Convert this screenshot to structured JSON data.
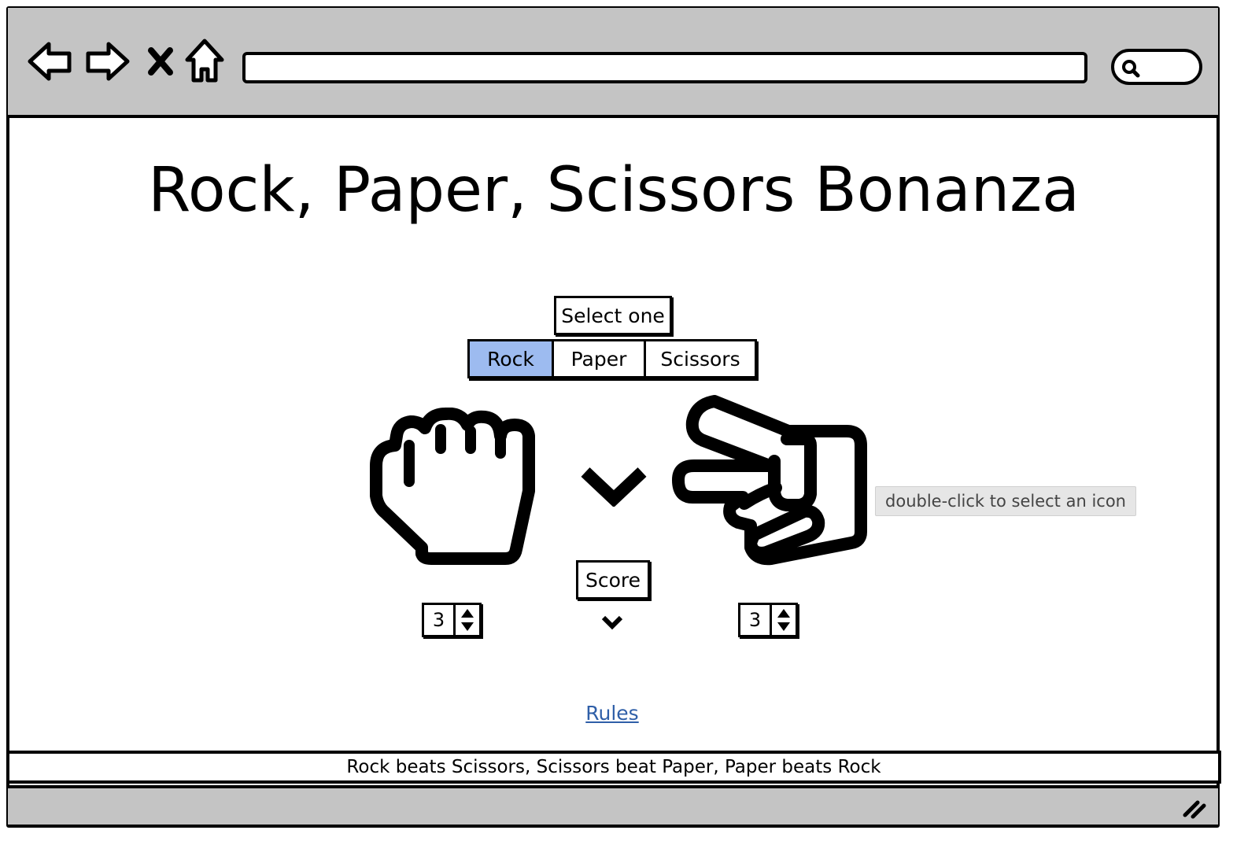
{
  "browser": {
    "back_icon": "back-arrow-icon",
    "forward_icon": "forward-arrow-icon",
    "close_icon": "close-x-icon",
    "home_icon": "home-icon",
    "search_icon": "search-icon",
    "resize_icon": "resize-grip-icon",
    "url": ""
  },
  "page": {
    "title": "Rock, Paper, Scissors Bonanza",
    "select_label": "Select one",
    "choices": [
      {
        "label": "Rock",
        "selected": true
      },
      {
        "label": "Paper",
        "selected": false
      },
      {
        "label": "Scissors",
        "selected": false
      }
    ],
    "player_hand_icon": "fist-rock-icon",
    "result_icon": "chevron-down-icon",
    "opponent_hand_icon": "hand-scissors-icon",
    "tooltip": "double-click to select an icon",
    "score_label": "Score",
    "player_score": "3",
    "opponent_score": "3",
    "rules_link": "Rules",
    "footer": "Rock beats Scissors, Scissors beat Paper, Paper beats Rock"
  },
  "colors": {
    "chrome": "#c4c4c4",
    "selected_segment": "#9dbbf0",
    "link": "#2f5fa8",
    "tooltip_bg": "#e6e6e6"
  }
}
